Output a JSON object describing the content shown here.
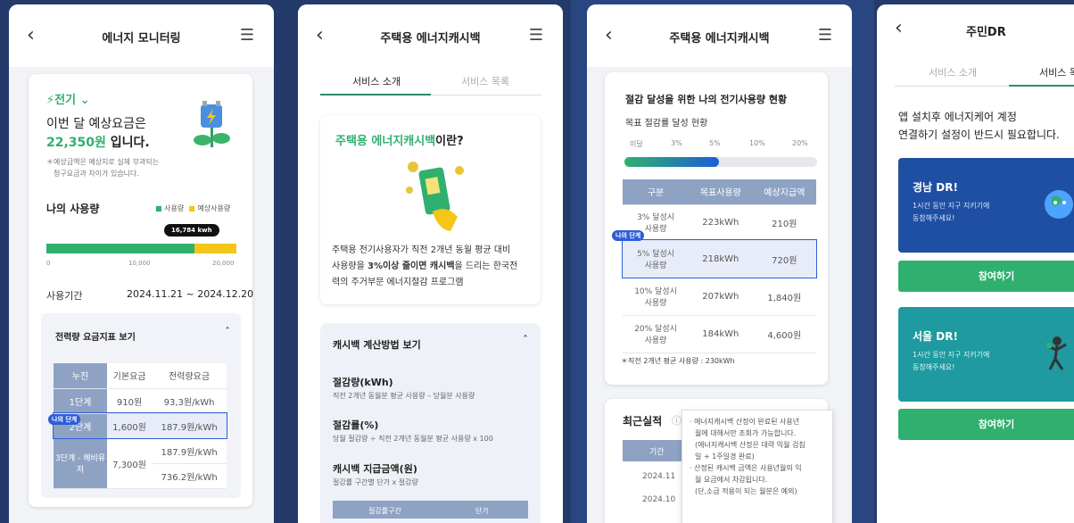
{
  "screen1": {
    "title": "에너지 모니터링",
    "energy_type": "⚡전기 ⌄",
    "est_line1": "이번 달 예상요금은",
    "est_amount": "22,350원",
    "est_suffix": " 입니다.",
    "note1": "＊예상금액은 예상치로 실제 부과되는",
    "note2": "청구요금과 차이가 있습니다.",
    "usage_title": "나의 사용량",
    "legend_used": "사용량",
    "legend_expected": "예상사용량",
    "usage_tooltip": "16,784 kwh",
    "usage_fraction": 0.78,
    "axis": [
      "0",
      "10,000",
      "20,000"
    ],
    "period_label": "사용기간",
    "period_value": "2024.11.21 ~ 2024.12.20",
    "rate_title": "전력량 요금지표 보기",
    "rate_headers": [
      "누진",
      "기본요금",
      "전력량요금"
    ],
    "rate_row1": [
      "1단계",
      "910원",
      "93,3원/kWh"
    ],
    "rate_row2": [
      "2단계",
      "1,600원",
      "187.9원/kWh"
    ],
    "rate_row3": [
      "3단계 - 헤비유저",
      "7,300원",
      "187.9원/kWh",
      "736.2원/kWh"
    ],
    "my_stage": "나의 단계",
    "colors": {
      "accent": "#2fb06e",
      "expected": "#f5c518",
      "table_head": "#8ea2c4"
    }
  },
  "screen2": {
    "title": "주택용 에너지캐시백",
    "tab1": "서비스 소개",
    "tab2": "서비스 목록",
    "intro_green": "주택용 에너지캐시백",
    "intro_black": "이란?",
    "desc1": "주택용 전기사용자가 직전 2개년 동월 평균 대비",
    "desc2a": "사용량을 ",
    "desc2b": "3%이상 줄이면 캐시백",
    "desc2c": "을 드리는 한국전",
    "desc3": "력의 주거부문 에너지절감 프로그램",
    "calc_title": "캐시백 계산방법 보기",
    "f1_title": "절감량(kWh)",
    "f1_desc": "직전 2개년 동월분 평균 사용량 – 당월분 사용량",
    "f2_title": "절감률(%)",
    "f2_desc": "당월 절감량 ÷ 직전 2개년 동월분 평균 사용량 x 100",
    "f3_title": "캐시백 지급금액(원)",
    "f3_desc": "절감률 구간별 단가 x 절감량",
    "th1": "절감률구간",
    "th2": "단가"
  },
  "screen3": {
    "title": "주택용 에너지캐시백",
    "status_title": "절감 달성을 위한 나의 전기사용량 현황",
    "goal_label": "목표 절감률 달성 현황",
    "scale": [
      "미달",
      "3%",
      "5%",
      "10%",
      "20%"
    ],
    "progress_fraction": 0.49,
    "headers": [
      "구분",
      "목표사용량",
      "예상지급액"
    ],
    "rows": [
      [
        "3% 달성시",
        "사용량",
        "223kWh",
        "210원"
      ],
      [
        "5% 달성시",
        "사용량",
        "218kWh",
        "720원"
      ],
      [
        "10% 달성시",
        "사용량",
        "207kWh",
        "1,840원"
      ],
      [
        "20% 달성시",
        "사용량",
        "184kWh",
        "4,600원"
      ]
    ],
    "my_stage": "나의 단계",
    "footnote": "＊직전 2개년 평균 사용량 : 230kWh",
    "recent_title": "최근실적",
    "recent_header": "기간",
    "recent_rows": [
      "2024.11",
      "2024.10"
    ],
    "tooltip": [
      "· 에너지캐시백 산정이 완료된 사용년",
      "월에 대해서만 조회가 가능합니다.",
      "(에너지캐시백 산정은 대략 익월 검침",
      "일 + 1주일경 완료)",
      "· 산정된 캐시백 금액은 사용년월의 익",
      "월 요금에서 차감됩니다.",
      "(단,소급 적용이 되는 월분은 예외)"
    ]
  },
  "screen4": {
    "title": "주민DR",
    "tab1": "서비스 소개",
    "tab2": "서비스 목",
    "intro1": "앱 설치후 에너지케어 계정",
    "intro2": "연결하기 설정이 반드시 필요합니다.",
    "card1_title": "경남 DR!",
    "card1_line1": "1시간 동안 지구 지키기에",
    "card1_line2": "동참해주세요!",
    "card2_title": "서울 DR!",
    "card2_line1": "1시간 동안 지구 지키기에",
    "card2_line2": "동참해주세요!",
    "join": "참여하기"
  }
}
